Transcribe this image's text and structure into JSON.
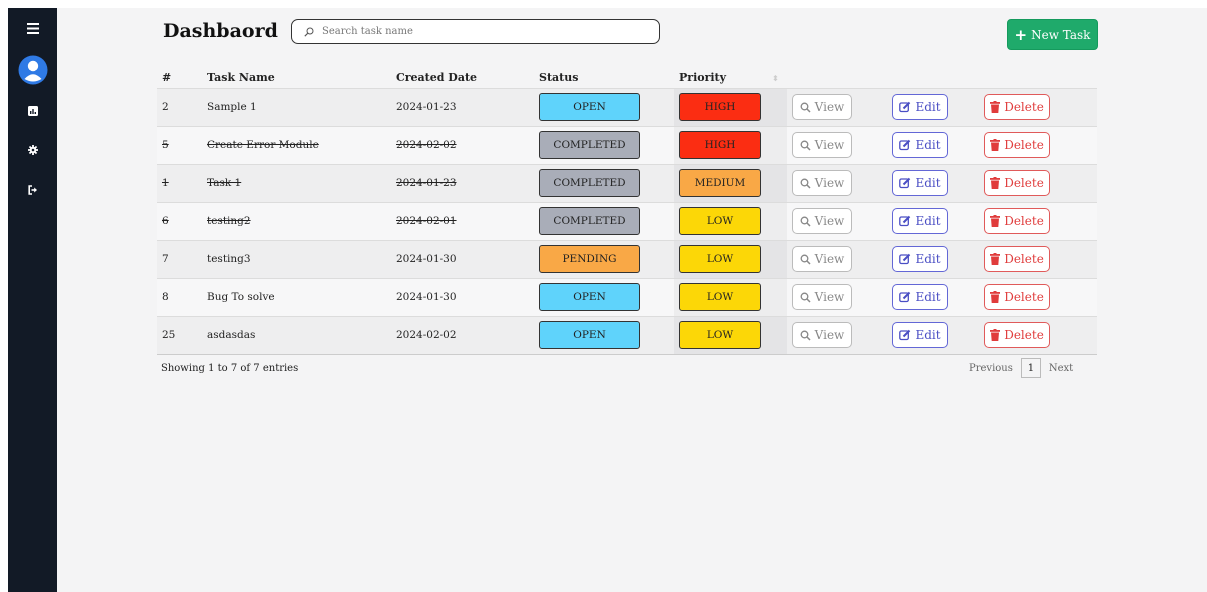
{
  "header": {
    "title": "Dashbaord",
    "search_placeholder": "Search task name",
    "new_task_label": "New Task"
  },
  "sidebar": {
    "items": [
      {
        "icon": "menu-icon"
      },
      {
        "icon": "avatar"
      },
      {
        "icon": "chart-icon"
      },
      {
        "icon": "gear-icon"
      },
      {
        "icon": "logout-icon"
      }
    ]
  },
  "table": {
    "columns": [
      "#",
      "Task Name",
      "Created Date",
      "Status",
      "Priority"
    ],
    "view_label": "View",
    "edit_label": "Edit",
    "delete_label": "Delete",
    "rows": [
      {
        "id": "2",
        "name": "Sample 1",
        "date": "2024-01-23",
        "status": "OPEN",
        "priority": "HIGH",
        "done": false
      },
      {
        "id": "5",
        "name": "Create Error Module",
        "date": "2024-02-02",
        "status": "COMPLETED",
        "priority": "HIGH",
        "done": true
      },
      {
        "id": "1",
        "name": "Task 1",
        "date": "2024-01-23",
        "status": "COMPLETED",
        "priority": "MEDIUM",
        "done": true
      },
      {
        "id": "6",
        "name": "testing2",
        "date": "2024-02-01",
        "status": "COMPLETED",
        "priority": "LOW",
        "done": true
      },
      {
        "id": "7",
        "name": "testing3",
        "date": "2024-01-30",
        "status": "PENDING",
        "priority": "LOW",
        "done": false
      },
      {
        "id": "8",
        "name": "Bug To solve",
        "date": "2024-01-30",
        "status": "OPEN",
        "priority": "LOW",
        "done": false
      },
      {
        "id": "25",
        "name": "asdasdas",
        "date": "2024-02-02",
        "status": "OPEN",
        "priority": "LOW",
        "done": false
      }
    ]
  },
  "footer": {
    "info": "Showing 1 to 7 of 7 entries",
    "previous": "Previous",
    "page": "1",
    "next": "Next"
  },
  "colors": {
    "status": {
      "OPEN": "#5fd3fb",
      "COMPLETED": "#a9adb8",
      "PENDING": "#f9a846"
    },
    "priority": {
      "HIGH": "#fb2d12",
      "MEDIUM": "#f9a846",
      "LOW": "#fcd707"
    }
  }
}
